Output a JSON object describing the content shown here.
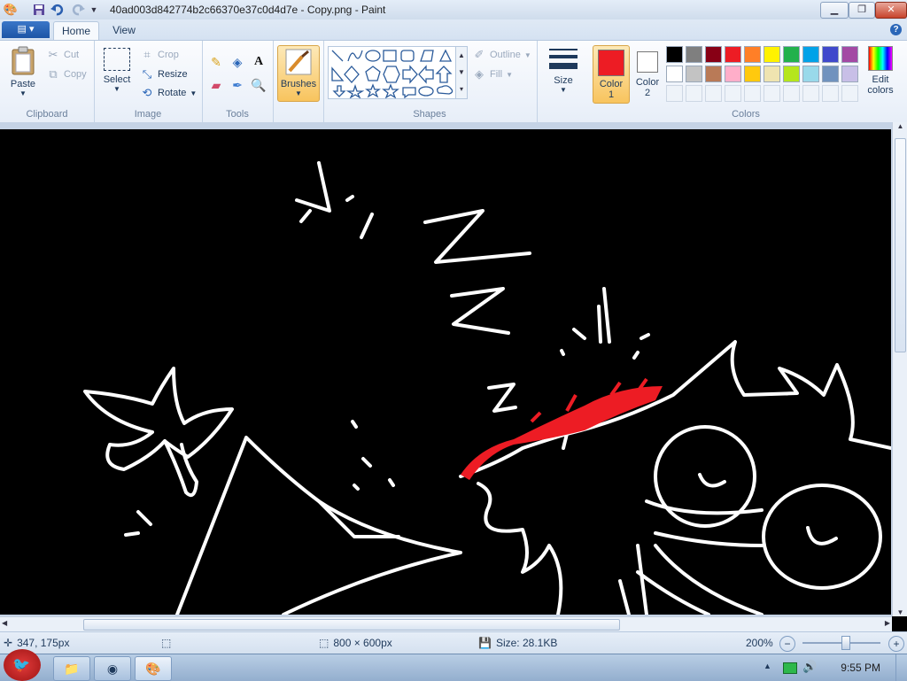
{
  "window": {
    "title": "40ad003d842774b2c66370e37c0d4d7e - Copy.png - Paint",
    "minimize_label": "▁",
    "maximize_label": "❐",
    "close_label": "✕"
  },
  "quick_access": {
    "app_icon": "paint-app-icon",
    "save_icon": "save-icon",
    "undo_icon": "undo-icon",
    "redo_icon": "redo-icon",
    "customize_icon": "dropdown-arrow-icon"
  },
  "tabs": [
    {
      "label": "Home",
      "active": true
    },
    {
      "label": "View",
      "active": false
    }
  ],
  "ribbon": {
    "clipboard": {
      "group_label": "Clipboard",
      "paste": "Paste",
      "cut": "Cut",
      "copy": "Copy"
    },
    "image": {
      "group_label": "Image",
      "select": "Select",
      "crop": "Crop",
      "resize": "Resize",
      "rotate": "Rotate"
    },
    "tools": {
      "group_label": "Tools"
    },
    "brushes": {
      "label": "Brushes"
    },
    "shapes": {
      "group_label": "Shapes",
      "outline": "Outline",
      "fill": "Fill"
    },
    "size": {
      "label": "Size"
    },
    "color1": {
      "label_line1": "Color",
      "label_line2": "1",
      "color": "#ed1c24"
    },
    "color2": {
      "label_line1": "Color",
      "label_line2": "2",
      "color": "#ffffff"
    },
    "colors": {
      "group_label": "Colors",
      "edit_line1": "Edit",
      "edit_line2": "colors",
      "palette_row1": [
        "#000000",
        "#7f7f7f",
        "#880015",
        "#ed1c24",
        "#ff7f27",
        "#fff200",
        "#22b14c",
        "#00a2e8",
        "#3f48cc",
        "#a349a4"
      ],
      "palette_row2": [
        "#ffffff",
        "#c3c3c3",
        "#b97a57",
        "#ffaec9",
        "#ffc90e",
        "#efe4b0",
        "#b5e61d",
        "#99d9ea",
        "#7092be",
        "#c8bfe7"
      ]
    }
  },
  "canvas": {
    "background": "#000000",
    "stroke_color": "#ffffff",
    "highlight_color": "#ed1c24"
  },
  "status": {
    "cursor_pos": "347, 175px",
    "image_size": "800 × 600px",
    "file_size": "Size: 28.1KB",
    "zoom": "200%"
  },
  "taskbar": {
    "clock": "9:55 PM"
  }
}
